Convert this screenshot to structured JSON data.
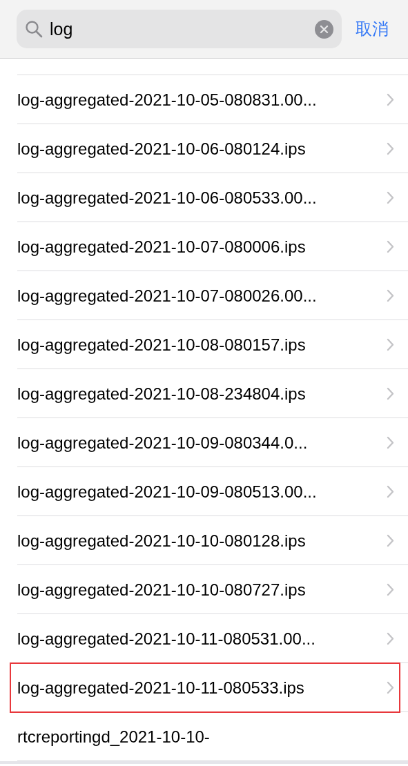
{
  "search": {
    "value": "log",
    "cancel": "取消"
  },
  "rows": [
    {
      "name": "log-aggregated-2021-10-05-080831.00...",
      "highlighted": false,
      "chevron": true
    },
    {
      "name": "log-aggregated-2021-10-06-080124.ips",
      "highlighted": false,
      "chevron": true
    },
    {
      "name": "log-aggregated-2021-10-06-080533.00...",
      "highlighted": false,
      "chevron": true
    },
    {
      "name": "log-aggregated-2021-10-07-080006.ips",
      "highlighted": false,
      "chevron": true
    },
    {
      "name": "log-aggregated-2021-10-07-080026.00...",
      "highlighted": false,
      "chevron": true
    },
    {
      "name": "log-aggregated-2021-10-08-080157.ips",
      "highlighted": false,
      "chevron": true
    },
    {
      "name": "log-aggregated-2021-10-08-234804.ips",
      "highlighted": false,
      "chevron": true
    },
    {
      "name": "log-aggregated-2021-10-09-080344.0...",
      "highlighted": false,
      "chevron": true
    },
    {
      "name": "log-aggregated-2021-10-09-080513.00...",
      "highlighted": false,
      "chevron": true
    },
    {
      "name": "log-aggregated-2021-10-10-080128.ips",
      "highlighted": false,
      "chevron": true
    },
    {
      "name": "log-aggregated-2021-10-10-080727.ips",
      "highlighted": false,
      "chevron": true
    },
    {
      "name": "log-aggregated-2021-10-11-080531.00...",
      "highlighted": false,
      "chevron": true
    },
    {
      "name": "log-aggregated-2021-10-11-080533.ips",
      "highlighted": true,
      "chevron": true
    },
    {
      "name": "rtcreportingd_2021-10-10-",
      "highlighted": false,
      "chevron": false
    }
  ]
}
